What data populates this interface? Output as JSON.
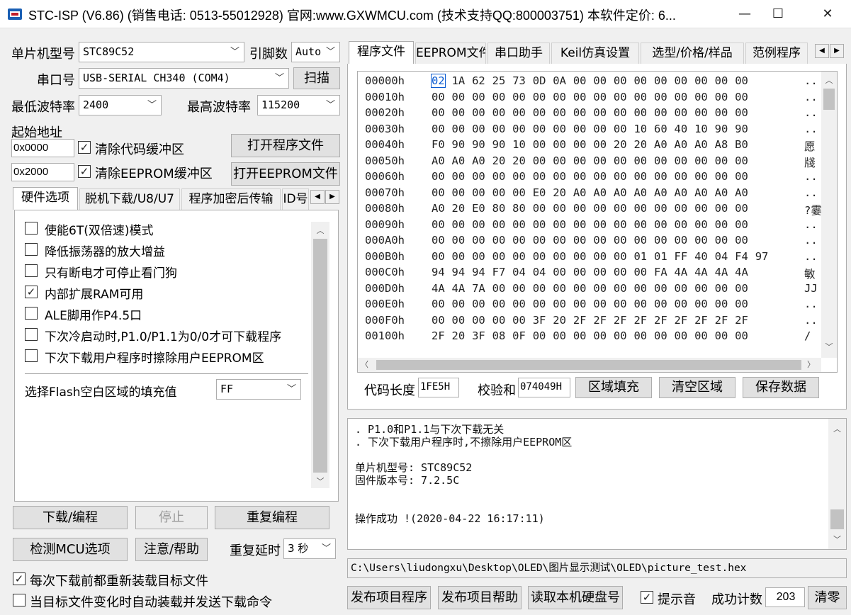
{
  "window": {
    "title": "STC-ISP (V6.86) (销售电话: 0513-55012928) 官网:www.GXWMCU.com  (技术支持QQ:800003751) 本软件定价: 6...",
    "min": "—",
    "max": "☐",
    "close": "✕"
  },
  "left": {
    "mcu_label": "单片机型号",
    "mcu_value": "STC89C52",
    "pin_label": "引脚数",
    "pin_value": "Auto",
    "port_label": "串口号",
    "port_value": "USB-SERIAL CH340 (COM4)",
    "scan_btn": "扫描",
    "min_baud_label": "最低波特率",
    "min_baud_value": "2400",
    "max_baud_label": "最高波特率",
    "max_baud_value": "115200",
    "start_addr_label": "起始地址",
    "code_addr": "0x0000",
    "clear_code": "清除代码缓冲区",
    "open_program": "打开程序文件",
    "eeprom_addr": "0x2000",
    "clear_eeprom": "清除EEPROM缓冲区",
    "open_eeprom": "打开EEPROM文件",
    "tabs": [
      "硬件选项",
      "脱机下载/U8/U7",
      "程序加密后传输",
      "ID号"
    ],
    "options": [
      {
        "label": "使能6T(双倍速)模式",
        "checked": false
      },
      {
        "label": "降低振荡器的放大增益",
        "checked": false
      },
      {
        "label": "只有断电才可停止看门狗",
        "checked": false
      },
      {
        "label": "内部扩展RAM可用",
        "checked": true
      },
      {
        "label": "ALE脚用作P4.5口",
        "checked": false
      },
      {
        "label": "下次冷启动时,P1.0/P1.1为0/0才可下载程序",
        "checked": false
      },
      {
        "label": "下次下载用户程序时擦除用户EEPROM区",
        "checked": false
      }
    ],
    "fill_label": "选择Flash空白区域的填充值",
    "fill_value": "FF",
    "btn_download": "下载/编程",
    "btn_stop": "停止",
    "btn_reprogram": "重复编程",
    "btn_detect": "检测MCU选项",
    "btn_help": "注意/帮助",
    "repeat_delay_label": "重复延时",
    "repeat_delay_value": "3 秒",
    "reload_label": "每次下载前都重新装载目标文件",
    "auto_label": "当目标文件变化时自动装载并发送下载命令"
  },
  "right": {
    "tabs": [
      "程序文件",
      "EEPROM文件",
      "串口助手",
      "Keil仿真设置",
      "选型/价格/样品",
      "范例程序"
    ],
    "hex_rows": [
      {
        "addr": "00000h",
        "bytes": "02 1A 62 25 73 0D 0A 00 00 00 00 00 00 00 00 00",
        "ascii": ".."
      },
      {
        "addr": "00010h",
        "bytes": "00 00 00 00 00 00 00 00 00 00 00 00 00 00 00 00",
        "ascii": ".."
      },
      {
        "addr": "00020h",
        "bytes": "00 00 00 00 00 00 00 00 00 00 00 00 00 00 00 00",
        "ascii": ".."
      },
      {
        "addr": "00030h",
        "bytes": "00 00 00 00 00 00 00 00 00 00 10 60 40 10 90 90",
        "ascii": ".."
      },
      {
        "addr": "00040h",
        "bytes": "F0 90 90 90 10 00 00 00 00 20 20 A0 A0 A0 A8 B0",
        "ascii": "愿"
      },
      {
        "addr": "00050h",
        "bytes": "A0 A0 A0 20 20 00 00 00 00 00 00 00 00 00 00 00",
        "ascii": "牋"
      },
      {
        "addr": "00060h",
        "bytes": "00 00 00 00 00 00 00 00 00 00 00 00 00 00 00 00",
        "ascii": ".."
      },
      {
        "addr": "00070h",
        "bytes": "00 00 00 00 00 E0 20 A0 A0 A0 A0 A0 A0 A0 A0 A0",
        "ascii": ".."
      },
      {
        "addr": "00080h",
        "bytes": "A0 20 E0 80 80 00 00 00 00 00 00 00 00 00 00 00",
        "ascii": "?霎"
      },
      {
        "addr": "00090h",
        "bytes": "00 00 00 00 00 00 00 00 00 00 00 00 00 00 00 00",
        "ascii": ".."
      },
      {
        "addr": "000A0h",
        "bytes": "00 00 00 00 00 00 00 00 00 00 00 00 00 00 00 00",
        "ascii": ".."
      },
      {
        "addr": "000B0h",
        "bytes": "00 00 00 00 00 00 00 00 00 00 01 01 FF 40 04 F4 97",
        "ascii": ".."
      },
      {
        "addr": "000C0h",
        "bytes": "94 94 94 F7 04 04 00 00 00 00 00 FA 4A 4A 4A 4A",
        "ascii": "敏"
      },
      {
        "addr": "000D0h",
        "bytes": "4A 4A 7A 00 00 00 00 00 00 00 00 00 00 00 00 00",
        "ascii": "JJ"
      },
      {
        "addr": "000E0h",
        "bytes": "00 00 00 00 00 00 00 00 00 00 00 00 00 00 00 00",
        "ascii": ".."
      },
      {
        "addr": "000F0h",
        "bytes": "00 00 00 00 00 3F 20 2F 2F 2F 2F 2F 2F 2F 2F 2F",
        "ascii": ".."
      },
      {
        "addr": "00100h",
        "bytes": "2F 20 3F 08 0F 00 00 00 00 00 00 00 00 00 00 00",
        "ascii": "/"
      }
    ],
    "code_len_label": "代码长度",
    "code_len_value": "1FE5H",
    "checksum_label": "校验和",
    "checksum_value": "074049H",
    "btn_fill": "区域填充",
    "btn_clear": "清空区域",
    "btn_save": "保存数据",
    "log_lines": [
      ". P1.0和P1.1与下次下载无关",
      ". 下次下载用户程序时,不擦除用户EEPROM区",
      "",
      "单片机型号: STC89C52",
      "固件版本号: 7.2.5C",
      "",
      "",
      "操作成功 !(2020-04-22 16:17:11)"
    ],
    "file_path": "C:\\Users\\liudongxu\\Desktop\\OLED\\图片显示测试\\OLED\\picture_test.hex",
    "btn_publish_prog": "发布项目程序",
    "btn_publish_help": "发布项目帮助",
    "btn_read_disk": "读取本机硬盘号",
    "hint_label": "提示音",
    "success_label": "成功计数",
    "success_count": "203",
    "btn_clear_count": "清零"
  }
}
